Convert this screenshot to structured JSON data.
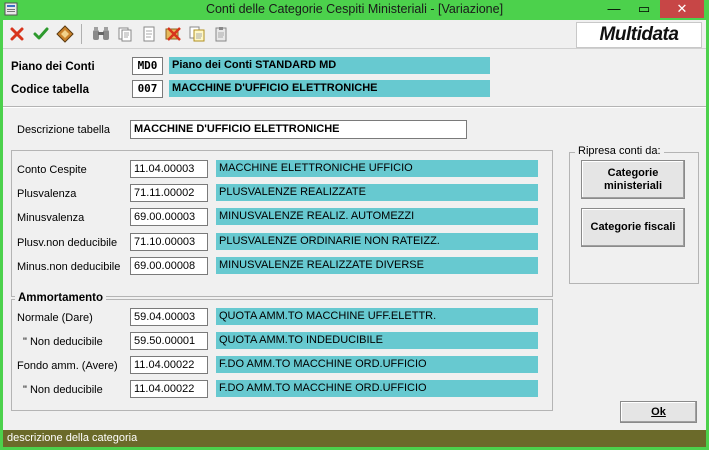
{
  "window": {
    "title": "Conti delle Categorie Cespiti Ministeriali - [Variazione]",
    "minimize_glyph": "—",
    "maximize_glyph": "▭",
    "close_glyph": "✕"
  },
  "toolbar": {
    "icons": [
      "cancel-icon",
      "confirm-icon",
      "edit-icon",
      "binoculars-icon",
      "copy-icon",
      "paste-icon",
      "delete-icon",
      "duplicate-icon",
      "clipboard-icon"
    ],
    "logo_text": "Multidata"
  },
  "header": {
    "piano_label": "Piano dei Conti",
    "piano_code": "MD0",
    "piano_desc": "Piano dei Conti STANDARD MD",
    "codice_label": "Codice tabella",
    "codice_code": "007",
    "codice_desc": "MACCHINE D'UFFICIO ELETTRONICHE"
  },
  "descrizione": {
    "label": "Descrizione tabella",
    "value": "MACCHINE D'UFFICIO ELETTRONICHE"
  },
  "conti": [
    {
      "label": "Conto Cespite",
      "code": "11.04.00003",
      "desc": "MACCHINE ELETTRONICHE UFFICIO"
    },
    {
      "label": "Plusvalenza",
      "code": "71.11.00002",
      "desc": "PLUSVALENZE REALIZZATE"
    },
    {
      "label": "Minusvalenza",
      "code": "69.00.00003",
      "desc": "MINUSVALENZE REALIZ. AUTOMEZZI"
    },
    {
      "label": "Plusv.non deducibile",
      "code": "71.10.00003",
      "desc": "PLUSVALENZE ORDINARIE NON RATEIZZ."
    },
    {
      "label": "Minus.non deducibile",
      "code": "69.00.00008",
      "desc": "MINUSVALENZE REALIZZATE DIVERSE"
    }
  ],
  "ammortamento": {
    "title": "Ammortamento",
    "rows": [
      {
        "label": "Normale  (Dare)",
        "code": "59.04.00003",
        "desc": "QUOTA AMM.TO MACCHINE UFF.ELETTR."
      },
      {
        "label": "\"  Non deducibile",
        "code": "59.50.00001",
        "desc": "QUOTA AMM.TO INDEDUCIBILE"
      },
      {
        "label": "Fondo amm. (Avere)",
        "code": "11.04.00022",
        "desc": "F.DO AMM.TO MACCHINE ORD.UFFICIO"
      },
      {
        "label": "\"  Non deducibile",
        "code": "11.04.00022",
        "desc": "F.DO AMM.TO MACCHINE ORD.UFFICIO"
      }
    ]
  },
  "ripresa": {
    "title": "Ripresa conti da:",
    "btn_ministeriali": "Categorie ministeriali",
    "btn_fiscali": "Categorie fiscali"
  },
  "ok_label": "Ok",
  "status_text": "descrizione della categoria"
}
